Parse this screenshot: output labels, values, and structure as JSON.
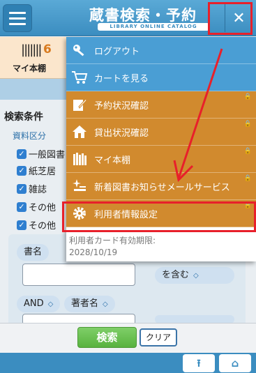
{
  "header": {
    "title": "蔵書検索・予約",
    "subtitle": "LIBRARY ONLINE CATALOG",
    "close_glyph": "✕"
  },
  "my_bookshelf": {
    "count": "6",
    "label": "マイ本棚"
  },
  "search_conditions": {
    "title": "検索条件",
    "material_type_label": "資料区分",
    "checkboxes": [
      "一般図書",
      "紙芝居",
      "雑誌",
      "その他",
      "その他"
    ],
    "field1": {
      "label": "書名",
      "match": "を含む"
    },
    "field2": {
      "operator": "AND",
      "label": "著者名"
    }
  },
  "menu": {
    "items": [
      {
        "label": "ログアウト",
        "icon": "key-icon",
        "style": "blue",
        "locked": false
      },
      {
        "label": "カートを見る",
        "icon": "cart-icon",
        "style": "blue",
        "locked": false
      },
      {
        "label": "予約状況確認",
        "icon": "edit-icon",
        "style": "orange",
        "locked": true
      },
      {
        "label": "貸出状況確認",
        "icon": "home-icon",
        "style": "orange",
        "locked": true
      },
      {
        "label": "マイ本棚",
        "icon": "books-icon",
        "style": "orange",
        "locked": true
      },
      {
        "label": "新着図書お知らせメールサービス",
        "icon": "sparkle-icon",
        "style": "orange",
        "locked": true
      },
      {
        "label": "利用者情報設定",
        "icon": "gear-icon",
        "style": "orange",
        "locked": true
      }
    ],
    "lock_glyph": "🔒",
    "expire_label": "利用者カード有効期限:",
    "expire_date": "2028/10/19"
  },
  "footer": {
    "search_label": "検索",
    "clear_label": "クリア"
  },
  "nav": {
    "top_glyph": "⭱",
    "home_glyph": "⌂"
  },
  "colors": {
    "header": "#3b8dc0",
    "menu_blue": "#4a9ed4",
    "menu_orange": "#d18a2e",
    "annotation": "#e8202a"
  }
}
